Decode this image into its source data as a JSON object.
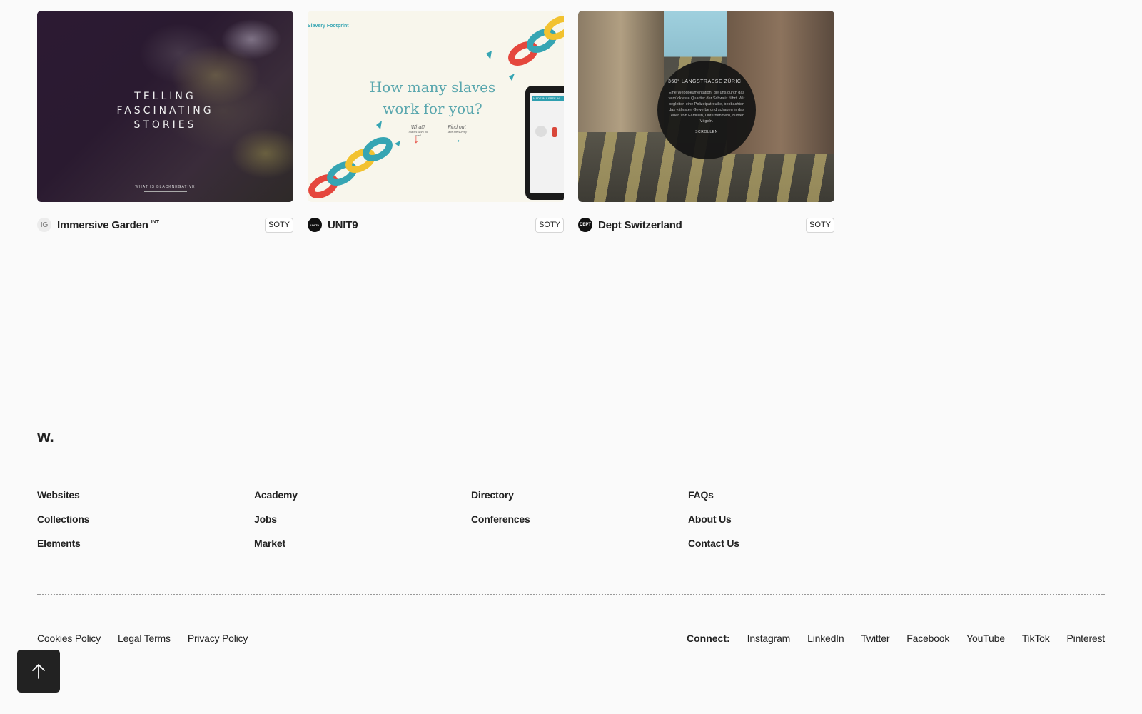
{
  "cards": [
    {
      "author": "Immersive Garden",
      "tag": "INT",
      "logo_text": "IG",
      "badge": "SOTY",
      "thumb": {
        "headline_lines": [
          "TELLING",
          "FASCINATING",
          "STORIES"
        ],
        "footer": "WHAT IS BLACKNEGATIVE"
      }
    },
    {
      "author": "UNIT9",
      "logo_text": "UNIT9",
      "badge": "SOTY",
      "thumb": {
        "brand": "Slavery Footprint",
        "question_lines": [
          "How many slaves",
          "work for you?"
        ],
        "what_label": "What?",
        "what_sub": "Slaves work for me?",
        "find_label": "Find out",
        "find_sub": "Take the survey",
        "phone_text": "MADE IN A FREE W..."
      }
    },
    {
      "author": "Dept Switzerland",
      "logo_text": "DEPT",
      "badge": "SOTY",
      "thumb": {
        "title": "360° LANGSTRASSE ZÜRICH",
        "body": "Eine Webdokumentation, die uns durch das verrückteste Quartier der Schweiz führt. Wir begleiten eine Polizeipatrouille, beobachten das «älteste» Gewerbe und schauen in das Leben von Familien, Unternehmern, bunten Vögeln.",
        "scroll": "SCROLLEN"
      }
    }
  ],
  "footer": {
    "logo": "W.",
    "columns": [
      [
        "Websites",
        "Collections",
        "Elements"
      ],
      [
        "Academy",
        "Jobs",
        "Market"
      ],
      [
        "Directory",
        "Conferences"
      ],
      [
        "FAQs",
        "About Us",
        "Contact Us"
      ]
    ],
    "legal": [
      "Cookies Policy",
      "Legal Terms",
      "Privacy Policy"
    ],
    "connect_label": "Connect:",
    "social": [
      "Instagram",
      "LinkedIn",
      "Twitter",
      "Facebook",
      "YouTube",
      "TikTok",
      "Pinterest"
    ]
  },
  "colors": {
    "background": "#fafafa",
    "text": "#222222",
    "back_to_top_bg": "#222222"
  },
  "icons": {
    "back_to_top": "arrow-up-icon"
  }
}
